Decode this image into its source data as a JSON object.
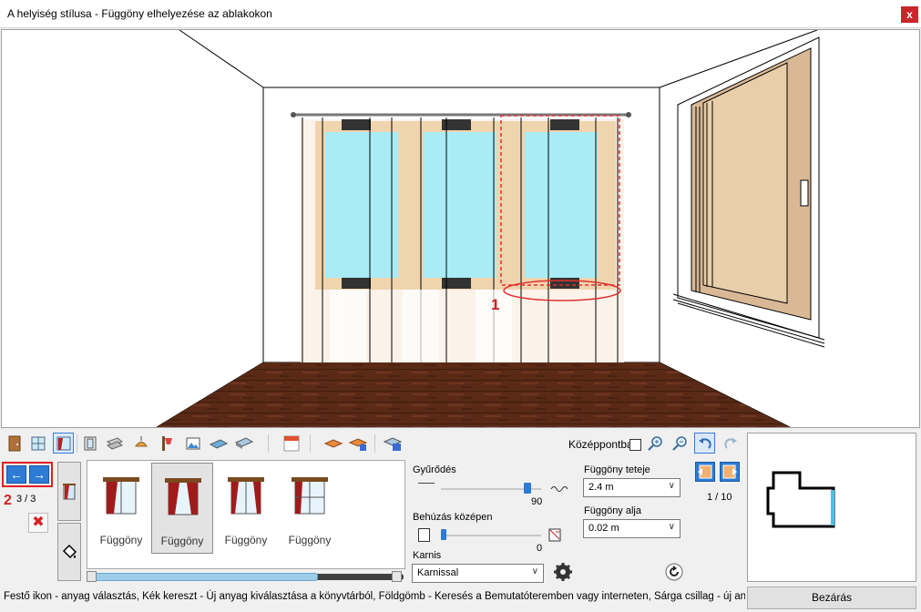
{
  "window": {
    "title": "A helyiség stílusa - Függöny elhelyezése az ablakokon",
    "close_glyph": "x"
  },
  "viewport": {
    "annotation_1": "1",
    "colors": {
      "floor": "#5a2a16",
      "window_glass": "#a9ecf5",
      "curtain_sheer": "#f6e6d2",
      "highlight": "#e03030"
    }
  },
  "toolbar": {
    "center_label": "Középpontba",
    "center_checked": false,
    "buttons": [
      "door-icon",
      "window-icon",
      "curtain-icon",
      "panel-icon",
      "blind-icon",
      "lamp-icon",
      "wall-lamp-icon",
      "picture-icon",
      "floor-icon",
      "ceiling-icon",
      "awning-icon",
      "sofa-icon",
      "kitchen-icon",
      "room-settings-icon",
      "zoom-in-icon",
      "zoom-out-icon",
      "undo-icon",
      "redo-icon"
    ]
  },
  "left_panel": {
    "annotation_2": "2",
    "counter": "3 / 3",
    "prev_glyph": "←",
    "next_glyph": "→",
    "delete_glyph": "✖"
  },
  "catalog": {
    "items": [
      {
        "label": "Függöny",
        "selected": false
      },
      {
        "label": "Függöny",
        "selected": true
      },
      {
        "label": "Függöny",
        "selected": false
      },
      {
        "label": "Függöny",
        "selected": false
      }
    ],
    "scroll_position": 0.72
  },
  "settings": {
    "gyurodes_label": "Gyűrődés",
    "gyurodes_value": "90",
    "behuzas_label": "Behúzás középen",
    "behuzas_value": "0",
    "karnis_label": "Karnis",
    "karnis_value": "Karnissal",
    "teteje_label": "Függöny teteje",
    "teteje_value": "2.4 m",
    "alja_label": "Függöny alja",
    "alja_value": "0.02 m"
  },
  "right_panel": {
    "page": "1 / 10"
  },
  "status_text": "Festő ikon - anyag választás, Kék kereszt - Új anyag kiválasztása a könyvtárból, Földgömb - Keresés a Bemutatóteremben vagy interneten, Sárga csillag - új anyag",
  "close_button": "Bezárás"
}
